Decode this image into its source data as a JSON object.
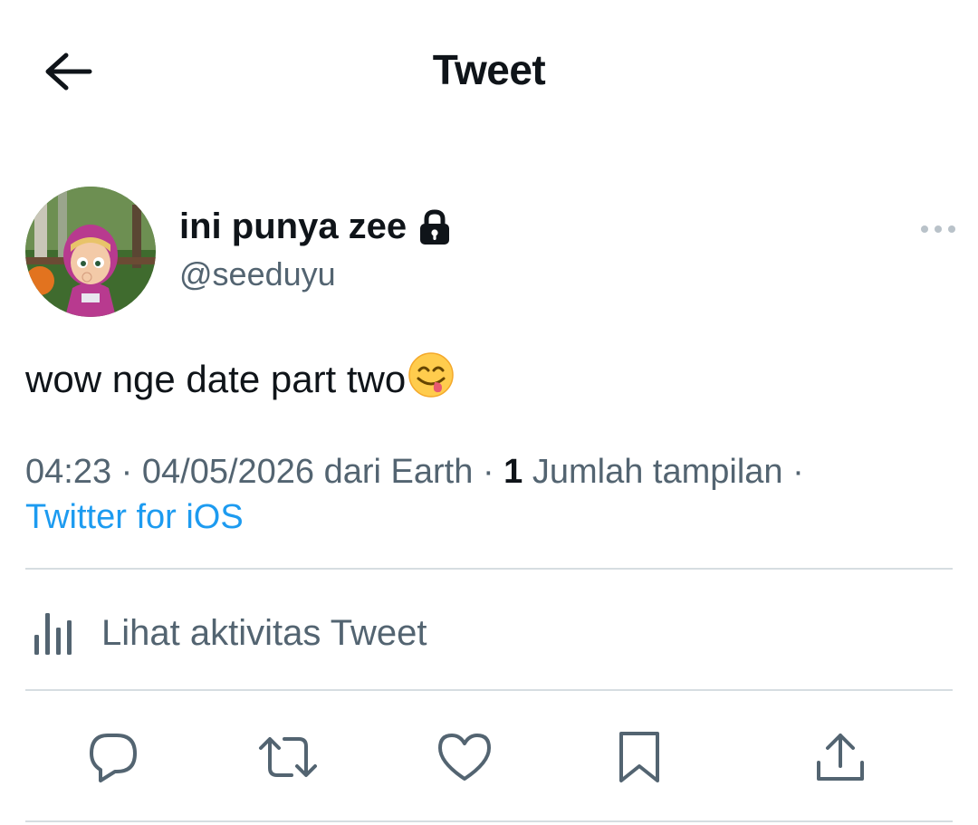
{
  "header": {
    "title": "Tweet",
    "back_icon": "arrow-left-icon"
  },
  "author": {
    "display_name": "ini punya zee",
    "handle": "@seeduyu",
    "protected_icon": "lock-icon",
    "avatar_icon": "avatar"
  },
  "tweet": {
    "text": "wow nge date part two",
    "emoji": "😋"
  },
  "meta": {
    "time": "04:23",
    "date": "04/05/2026",
    "location_text": "dari Earth",
    "separator": "·",
    "views_count": "1",
    "views_label": "Jumlah tampilan",
    "source": "Twitter for iOS"
  },
  "activity": {
    "label": "Lihat aktivitas Tweet",
    "icon": "bar-chart-icon"
  },
  "actions": [
    {
      "name": "reply",
      "icon": "reply-icon"
    },
    {
      "name": "retweet",
      "icon": "retweet-icon"
    },
    {
      "name": "like",
      "icon": "heart-icon"
    },
    {
      "name": "bookmark",
      "icon": "bookmark-icon"
    },
    {
      "name": "share",
      "icon": "share-icon"
    }
  ],
  "colors": {
    "text_primary": "#0f1419",
    "text_secondary": "#536471",
    "link": "#1d9bf0",
    "divider": "#d6dde1"
  }
}
